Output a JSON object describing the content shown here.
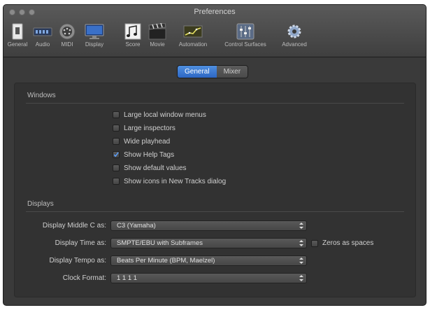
{
  "window": {
    "title": "Preferences"
  },
  "toolbar": {
    "items": [
      {
        "label": "General",
        "icon": "general-icon"
      },
      {
        "label": "Audio",
        "icon": "audio-icon"
      },
      {
        "label": "MIDI",
        "icon": "midi-icon"
      },
      {
        "label": "Display",
        "icon": "display-icon"
      },
      {
        "label": "Score",
        "icon": "score-icon"
      },
      {
        "label": "Movie",
        "icon": "movie-icon"
      },
      {
        "label": "Automation",
        "icon": "automation-icon"
      },
      {
        "label": "Control Surfaces",
        "icon": "control-surfaces-icon"
      },
      {
        "label": "Advanced",
        "icon": "advanced-icon"
      }
    ]
  },
  "tabs": {
    "general": "General",
    "mixer": "Mixer",
    "selected": "General"
  },
  "windows_section": {
    "title": "Windows",
    "options": [
      {
        "label": "Large local window menus",
        "checked": false
      },
      {
        "label": "Large inspectors",
        "checked": false
      },
      {
        "label": "Wide playhead",
        "checked": false
      },
      {
        "label": "Show Help Tags",
        "checked": true
      },
      {
        "label": "Show default values",
        "checked": false
      },
      {
        "label": "Show icons in New Tracks dialog",
        "checked": false
      }
    ]
  },
  "displays_section": {
    "title": "Displays",
    "middle_c": {
      "label": "Display Middle C as:",
      "value": "C3 (Yamaha)"
    },
    "time": {
      "label": "Display Time as:",
      "value": "SMPTE/EBU with Subframes"
    },
    "zeros": {
      "label": "Zeros as spaces",
      "checked": false
    },
    "tempo": {
      "label": "Display Tempo as:",
      "value": "Beats Per Minute (BPM, Maelzel)"
    },
    "clock": {
      "label": "Clock Format:",
      "value": "1 1 1 1"
    }
  },
  "colors": {
    "accent": "#2d67c4",
    "window_bg": "#3a3a3a",
    "panel_bg": "#323232"
  }
}
